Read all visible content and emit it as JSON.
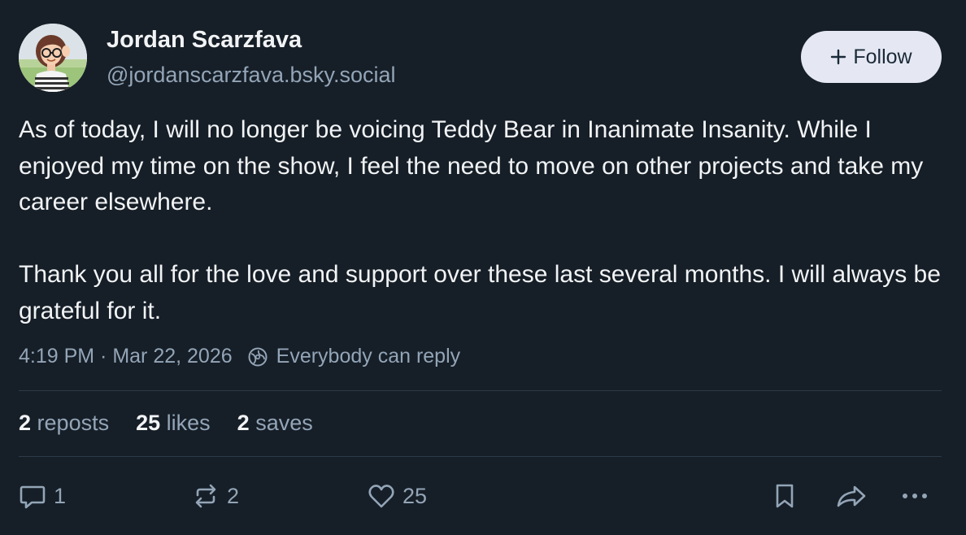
{
  "author": {
    "display_name": "Jordan Scarzfava",
    "handle": "@jordanscarzfava.bsky.social"
  },
  "follow_button": {
    "label": "Follow",
    "icon": "plus-icon"
  },
  "post": {
    "paragraphs": [
      "As of today, I will no longer be voicing Teddy Bear in Inanimate Insanity. While I enjoyed my time on the show, I feel the need to move on other projects and take my career elsewhere.",
      "Thank you all for the love and support over these last several months. I will always be grateful for it."
    ],
    "timestamp": "4:19 PM · Mar 22, 2026",
    "reply_setting": "Everybody can reply"
  },
  "stats": {
    "reposts_count": "2",
    "reposts_label": "reposts",
    "likes_count": "25",
    "likes_label": "likes",
    "saves_count": "2",
    "saves_label": "saves"
  },
  "actions": {
    "reply_count": "1",
    "repost_count": "2",
    "like_count": "25"
  },
  "colors": {
    "background": "#161e27",
    "text_primary": "#f1f3f5",
    "text_secondary": "#93a5b7",
    "follow_button_bg": "#e5e8f2",
    "divider": "#2c3a49"
  }
}
